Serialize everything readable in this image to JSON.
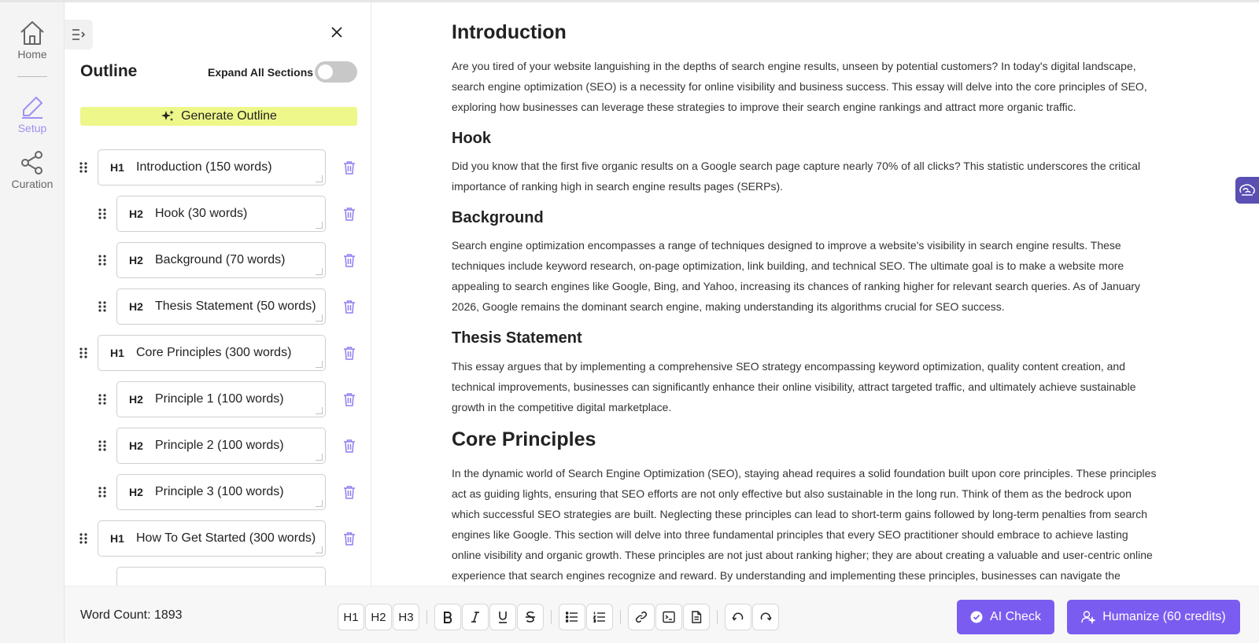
{
  "rail": {
    "home_label": "Home",
    "setup_label": "Setup",
    "curation_label": "Curation"
  },
  "outline": {
    "title": "Outline",
    "expand_label": "Expand All Sections",
    "expand_enabled": false,
    "generate_label": "Generate Outline",
    "items": [
      {
        "level": "H1",
        "text": "Introduction (150 words)"
      },
      {
        "level": "H2",
        "text": "Hook (30 words)"
      },
      {
        "level": "H2",
        "text": "Background (70 words)"
      },
      {
        "level": "H2",
        "text": "Thesis Statement (50 words)"
      },
      {
        "level": "H1",
        "text": "Core Principles (300 words)"
      },
      {
        "level": "H2",
        "text": "Principle 1 (100 words)"
      },
      {
        "level": "H2",
        "text": "Principle 2 (100 words)"
      },
      {
        "level": "H2",
        "text": "Principle 3 (100 words)"
      },
      {
        "level": "H1",
        "text": "How To Get Started (300 words)"
      }
    ]
  },
  "document": {
    "intro_heading": "Introduction",
    "intro_text": "Are you tired of your website languishing in the depths of search engine results, unseen by potential customers? In today's digital landscape, search engine optimization (SEO) is a necessity for online visibility and business success. This essay will delve into the core principles of SEO, exploring how businesses can leverage these strategies to improve their search engine rankings and attract more organic traffic.",
    "hook_heading": "Hook",
    "hook_text": "Did you know that the first five organic results on a Google search page capture nearly 70% of all clicks? This statistic underscores the critical importance of ranking high in search engine results pages (SERPs).",
    "background_heading": "Background",
    "background_text": "Search engine optimization encompasses a range of techniques designed to improve a website's visibility in search engine results. These techniques include keyword research, on-page optimization, link building, and technical SEO. The ultimate goal is to make a website more appealing to search engines like Google, Bing, and Yahoo, increasing its chances of ranking higher for relevant search queries. As of January 2026, Google remains the dominant search engine, making understanding its algorithms crucial for SEO success.",
    "thesis_heading": "Thesis Statement",
    "thesis_text": "This essay argues that by implementing a comprehensive SEO strategy encompassing keyword optimization, quality content creation, and technical improvements, businesses can significantly enhance their online visibility, attract targeted traffic, and ultimately achieve sustainable growth in the competitive digital marketplace.",
    "core_heading": "Core Principles",
    "core_text": "In the dynamic world of Search Engine Optimization (SEO), staying ahead requires a solid foundation built upon core principles. These principles act as guiding lights, ensuring that SEO efforts are not only effective but also sustainable in the long run. Think of them as the bedrock upon which successful SEO strategies are built. Neglecting these principles can lead to short-term gains followed by long-term penalties from search engines like Google. This section will delve into three fundamental principles that every SEO practitioner should embrace to achieve lasting online visibility and organic growth. These principles are not just about ranking higher; they are about creating a valuable and user-centric online experience that search engines recognize and reward. By understanding and implementing these principles, businesses can navigate the"
  },
  "toolbar": {
    "word_count": "Word Count: 1893",
    "h1": "H1",
    "h2": "H2",
    "h3": "H3",
    "ai_check_label": "AI Check",
    "humanize_label": "Humanize (60 credits)"
  },
  "colors": {
    "accent": "#7b5cf0",
    "generate_bg": "#eef78a",
    "trash": "#8f7ff0",
    "setup_active": "#a08ff0"
  }
}
